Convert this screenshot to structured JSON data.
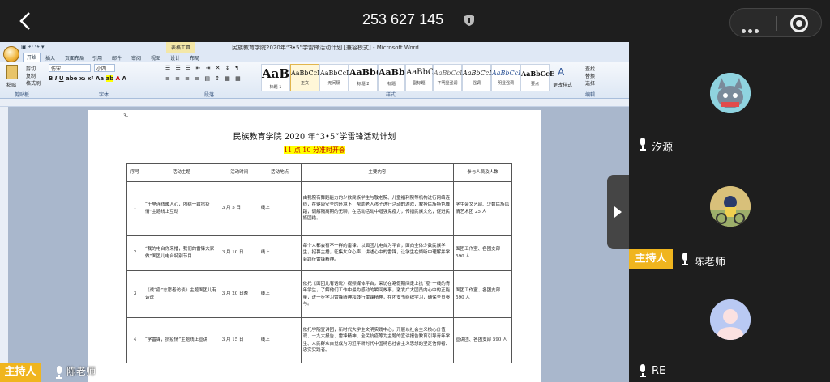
{
  "meeting": {
    "id": "253 627 145"
  },
  "word": {
    "doc_title": "民族教育学院2020年“3•5”学雷锋活动计划 [兼容模式] - Microsoft Word",
    "context_tool": "表格工具",
    "tabs": [
      "开始",
      "插入",
      "页面布局",
      "引用",
      "邮件",
      "审阅",
      "视图",
      "设计",
      "布局"
    ],
    "clipboard": {
      "paste": "粘贴",
      "cut": "剪切",
      "copy": "复制",
      "format": "格式刷"
    },
    "font_name": "仿宋",
    "font_size": "小四",
    "styles": [
      {
        "sample": "AaB",
        "name": "标题 1"
      },
      {
        "sample": "AaBbCcD",
        "name": "正文"
      },
      {
        "sample": "AaBbCcD",
        "name": "无间隔"
      },
      {
        "sample": "AaBb(",
        "name": "标题 2"
      },
      {
        "sample": "AaBb(",
        "name": "标题"
      },
      {
        "sample": "AaBbC",
        "name": "副标题"
      },
      {
        "sample": "AaBbCcD",
        "name": "不明显强调"
      },
      {
        "sample": "AaBbCcD",
        "name": "强调"
      },
      {
        "sample": "AaBbCcD",
        "name": "明显强调"
      },
      {
        "sample": "AaBbCcE",
        "name": "要点"
      }
    ],
    "change_styles": "更改样式",
    "editing": {
      "find": "查找",
      "replace": "替换",
      "select": "选择"
    },
    "group_labels": [
      "剪贴板",
      "字体",
      "段落",
      "样式",
      "编辑"
    ]
  },
  "document": {
    "page_mark": "3-",
    "title": "民族教育学院 2020 年“3•5”学雷锋活动计划",
    "subtitle": "11 点 10 分准时开会",
    "headers": [
      "序号",
      "活动主题",
      "活动时间",
      "活动地点",
      "主要内容",
      "参与人员及人数"
    ],
    "rows": [
      {
        "no": "1",
        "theme": "“千里连线暖人心，团结一致抗疫情”主题线上互动",
        "time": "3 月 5 日",
        "place": "线上",
        "content": "由我院有舞蹈能力的少数民族学生与敬老院、儿童福利院等机构进行网络连线，在健康安全的环境下，帮助老人孩子进行活动的游戏，教授民族特色舞蹈，调解隔离期的无聊，在活动活动中增强免疫力，传播民族文化，促进民族团结。",
        "who": "学生会文艺部、少数民族风情艺术团 25 人"
      },
      {
        "no": "2",
        "theme": "“我的电台你来播，我们的雷锋大家做”面团儿电台特别节目",
        "time": "3 月 10 日",
        "place": "线上",
        "content": "每个人都会有不一样的雷锋，以面团儿电台为平台，面向全体少数民族学生，招募主播，征集大众心声，讲述心中的雷锋，让学生在倾听中理解并学会践行雷锋精神。",
        "who": "面团工作室、各团支部 590 人"
      },
      {
        "no": "3",
        "theme": "《战“疫”志愿者访谈》主题面团儿有话说",
        "time": "3 月 20 日晚",
        "place": "线上",
        "content": "依托《面团儿有话说》视频媒体平台，采访在寒假期间走上抗“疫”一线的青年学生，了解他们工作中最为感动的瞬间故事，激发广大团员内心中的正能量，进一步学习雷锋精神和践行雷锋精神，在团支书组织学习，确保全员参与。",
        "who": "面团工作室、各团支部 590 人"
      },
      {
        "no": "4",
        "theme": "“学雷锋，抗疫情”主题线上宣讲",
        "time": "3 月 15 日",
        "place": "线上",
        "content": "依托学院宣讲团，新时代大学生文明实践中心，开展以社会主义核心价值观、十九大报告、雷锋精神、全民抗疫等为主题的宣讲报告教育引导青年学生、人民群众自觉成为习近平新时代中国特色社会主义思想的坚定信仰者、忠实实践者。",
        "who": "宣讲团、各团支部 590 人"
      }
    ]
  },
  "participants": [
    {
      "name": "汐源",
      "host": false
    },
    {
      "name": "陈老师",
      "host": true
    },
    {
      "name": "RE",
      "host": false
    }
  ],
  "host_label": "主持人",
  "bottom_overlay_name": "陈老师"
}
